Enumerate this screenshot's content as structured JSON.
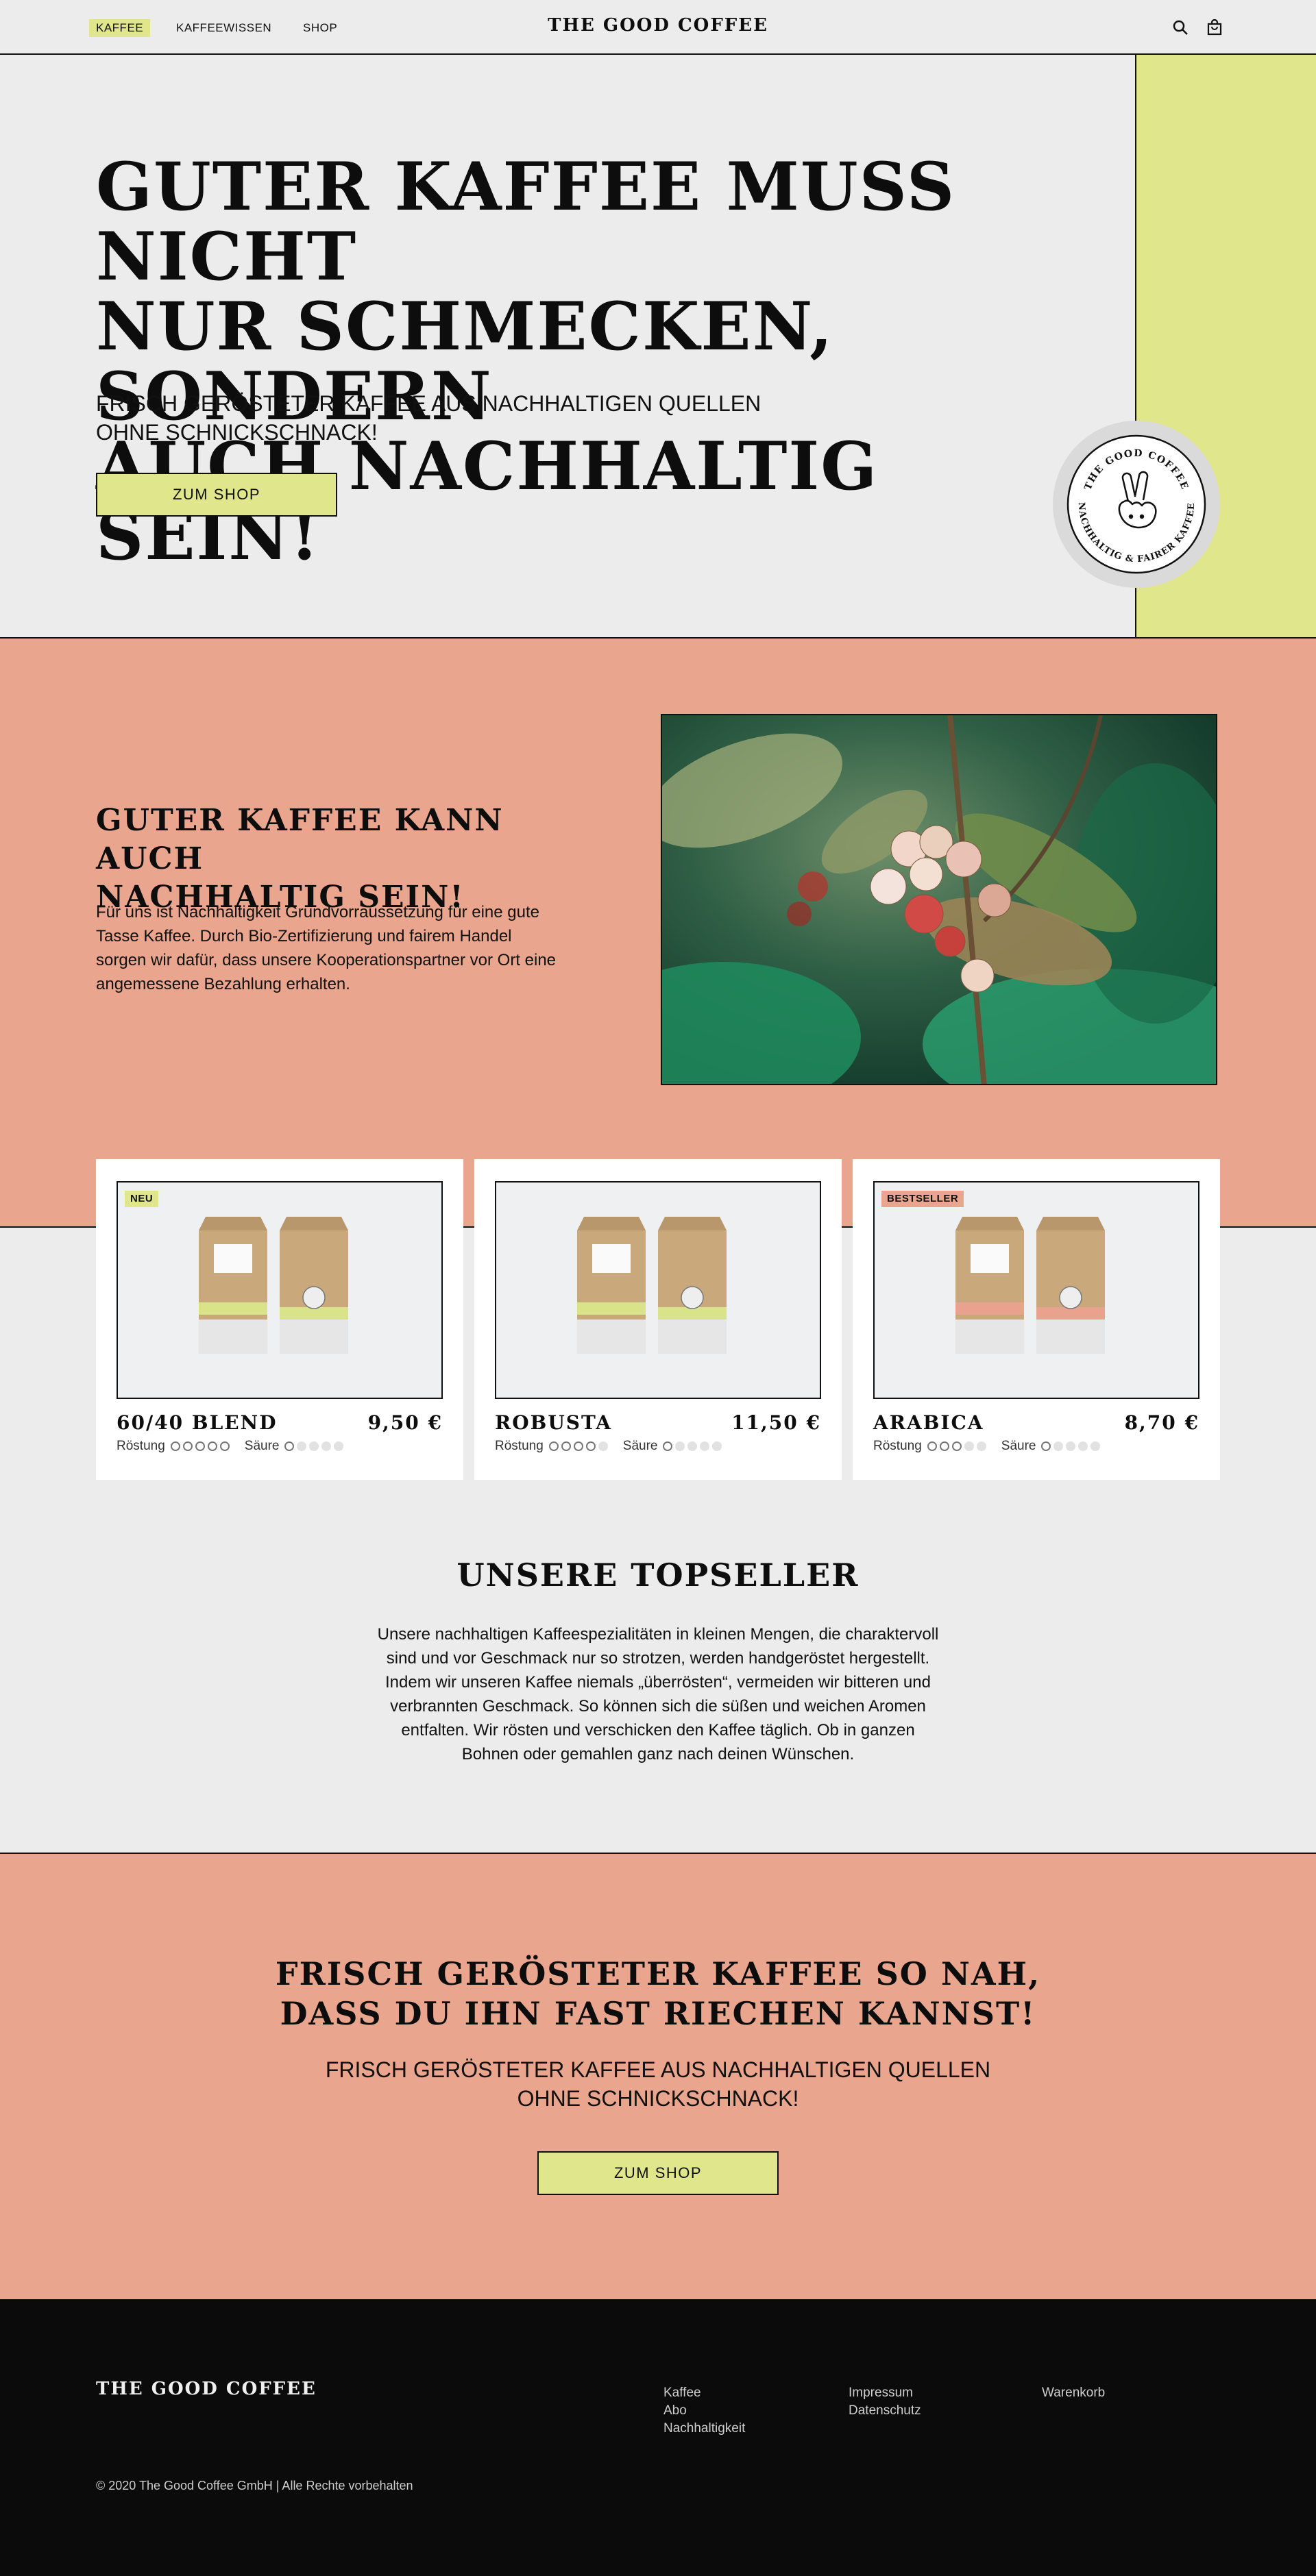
{
  "nav": {
    "links": [
      "KAFFEE",
      "KAFFEEWISSEN",
      "SHOP"
    ],
    "logo": "THE GOOD COFFEE",
    "icons": [
      "search-icon",
      "cart-icon"
    ]
  },
  "hero": {
    "title_lines": [
      "GUTER KAFFEE MUSS NICHT",
      "NUR SCHMECKEN, SONDERN",
      "AUCH NACHHALTIG SEIN!"
    ],
    "subtitle_lines": [
      "FRISCH GERÖSTETER KAFFEE AUS NACHHALTIGEN QUELLEN",
      "OHNE SCHNICKSCHNACK!"
    ],
    "button": "ZUM SHOP",
    "badge_top": "THE GOOD COFFEE",
    "badge_bottom": "NACHHALTIG & FAIRER KAFFEE"
  },
  "sustain": {
    "title_lines": [
      "GUTER KAFFEE KANN AUCH",
      "NACHHALTIG SEIN!"
    ],
    "text": "Für uns ist Nachhaltigkeit Grundvorraussetzung für eine gute Tasse Kaffee. Durch Bio-Zertifizierung und fairem Handel sorgen wir dafür, dass unsere Kooperationspartner vor Ort eine angemessene Bezahlung erhalten."
  },
  "products": [
    {
      "name": "60/40 BLEND",
      "price": "9,50 €",
      "tag": "NEU",
      "tag_color": "#dfe68c",
      "band_color": "#d9e48a",
      "roast": 5,
      "acid": 1
    },
    {
      "name": "ROBUSTA",
      "price": "11,50 €",
      "tag": "",
      "tag_color": "",
      "band_color": "#d9e48a",
      "roast": 4,
      "acid": 1
    },
    {
      "name": "ARABICA",
      "price": "8,70 €",
      "tag": "BESTSELLER",
      "tag_color": "#e9a58d",
      "band_color": "#e8a28e",
      "roast": 3,
      "acid": 1
    }
  ],
  "labels": {
    "roast": "Röstung",
    "acid": "Säure"
  },
  "topseller": {
    "title": "UNSERE TOPSELLER",
    "text": "Unsere nachhaltigen Kaffeespezialitäten in kleinen Mengen, die charaktervoll sind und vor Geschmack nur so strotzen, werden handgeröstet hergestellt. Indem wir unseren Kaffee niemals „überrösten“, vermeiden wir bitteren und verbrannten Geschmack. So können sich die süßen und weichen Aromen entfalten. Wir rösten und verschicken den Kaffee täglich. Ob in ganzen Bohnen oder gemahlen ganz nach deinen Wünschen."
  },
  "cta": {
    "title_lines": [
      "FRISCH GERÖSTETER KAFFEE SO NAH,",
      "DASS DU IHN FAST RIECHEN KANNST!"
    ],
    "subtitle_lines": [
      "FRISCH GERÖSTETER KAFFEE AUS NACHHALTIGEN QUELLEN",
      "OHNE SCHNICKSCHNACK!"
    ],
    "button": "ZUM SHOP"
  },
  "footer": {
    "logo": "THE GOOD COFFEE",
    "col1": [
      "Kaffee",
      "Abo",
      "Nachhaltigkeit"
    ],
    "col2": [
      "Impressum",
      "Datenschutz"
    ],
    "col3": [
      "Warenkorb"
    ],
    "copyright": "© 2020 The Good Coffee GmbH | Alle Rechte vorbehalten"
  },
  "colors": {
    "lime": "#dfe68c",
    "salmon": "#e9a58d",
    "bg": "#ececec",
    "footer": "#0b0b0b"
  }
}
